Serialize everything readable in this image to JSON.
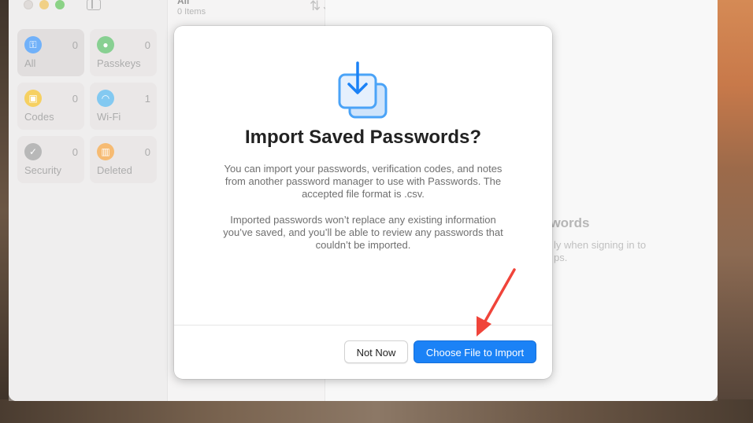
{
  "window": {
    "list_title": "All",
    "list_count": "0 Items",
    "sort_icon": "sort-icon",
    "add_icon": "plus-icon"
  },
  "sidebar": {
    "tiles": [
      {
        "label": "All",
        "count": "0",
        "icon": "key-icon",
        "color": "#1b82f6"
      },
      {
        "label": "Passkeys",
        "count": "0",
        "icon": "person-icon",
        "color": "#3fb34f"
      },
      {
        "label": "Codes",
        "count": "0",
        "icon": "lock-icon",
        "color": "#f0b400"
      },
      {
        "label": "Wi-Fi",
        "count": "1",
        "icon": "wifi-icon",
        "color": "#37a8e8"
      },
      {
        "label": "Security",
        "count": "0",
        "icon": "checkmark-icon",
        "color": "#8d8d8d"
      },
      {
        "label": "Deleted",
        "count": "0",
        "icon": "trash-icon",
        "color": "#f0921e"
      }
    ]
  },
  "detail": {
    "heading": "swords",
    "text_line1": "ly when signing in to",
    "text_line2": "ps."
  },
  "modal": {
    "title": "Import Saved Passwords?",
    "paragraph1": "You can import your passwords, verification codes, and notes from another password manager to use with Passwords. The accepted file format is .csv.",
    "paragraph2": "Imported passwords won’t replace any existing information you’ve saved, and you’ll be able to review any passwords that couldn’t be imported.",
    "cancel_label": "Not Now",
    "confirm_label": "Choose File to Import",
    "accent": "#1b82f6"
  },
  "annotation": {
    "arrow_color": "#f0443a"
  }
}
